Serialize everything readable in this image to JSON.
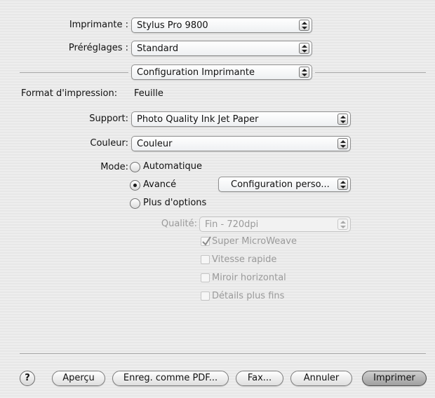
{
  "printer": {
    "label": "Imprimante :",
    "value": "Stylus Pro 9800"
  },
  "presets": {
    "label": "Préréglages :",
    "value": "Standard"
  },
  "panel": {
    "value": "Configuration Imprimante"
  },
  "print_format": {
    "label": "Format d'impression:",
    "value": "Feuille"
  },
  "media": {
    "label": "Support:",
    "value": "Photo Quality Ink Jet Paper"
  },
  "color": {
    "label": "Couleur:",
    "value": "Couleur"
  },
  "mode": {
    "label": "Mode:",
    "options": [
      "Automatique",
      "Avancé",
      "Plus d'options"
    ],
    "selected": "Avancé",
    "advanced_setting": "Configuration perso..."
  },
  "quality": {
    "label": "Qualité:",
    "value": "Fin - 720dpi",
    "enabled": false
  },
  "checkboxes": [
    {
      "label": "Super MicroWeave",
      "checked": true
    },
    {
      "label": "Vitesse rapide",
      "checked": false
    },
    {
      "label": "Miroir horizontal",
      "checked": false
    },
    {
      "label": "Détails plus fins",
      "checked": false
    }
  ],
  "buttons": {
    "help": "?",
    "preview": "Aperçu",
    "save_pdf": "Enreg. comme PDF...",
    "fax": "Fax...",
    "cancel": "Annuler",
    "print": "Imprimer"
  },
  "colors": {
    "background": "#ececec",
    "default_button": "#a9a9a9"
  }
}
